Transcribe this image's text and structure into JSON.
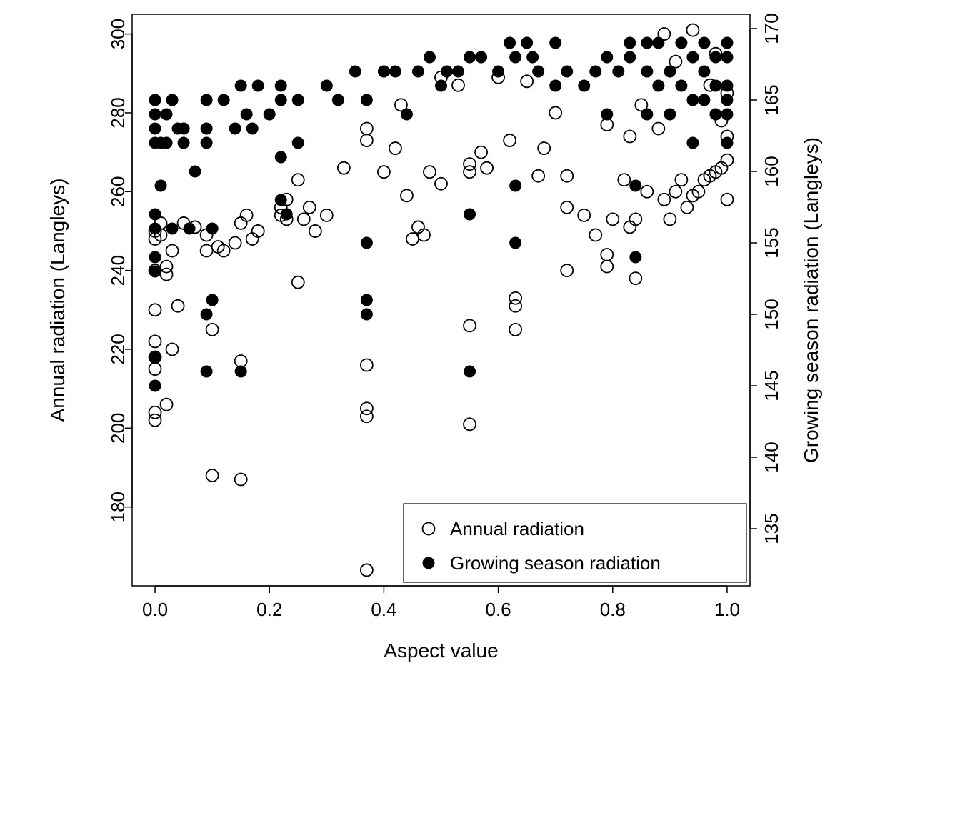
{
  "chart_data": {
    "type": "scatter",
    "xlabel": "Aspect value",
    "ylabel_left": "Annual radiation (Langleys)",
    "ylabel_right": "Growing season radiation (Langleys)",
    "xlim": [
      -0.04,
      1.04
    ],
    "ylim_left": [
      160,
      305
    ],
    "ylim_right": [
      131,
      171
    ],
    "xticks": [
      0.0,
      0.2,
      0.4,
      0.6,
      0.8,
      1.0
    ],
    "yticks_left": [
      180,
      200,
      220,
      240,
      260,
      280,
      300
    ],
    "yticks_right": [
      135,
      140,
      145,
      150,
      155,
      160,
      165,
      170
    ],
    "legend": {
      "entries": [
        {
          "label": "Annual radiation",
          "marker": "open"
        },
        {
          "label": "Growing season radiation",
          "marker": "filled"
        }
      ]
    },
    "series": [
      {
        "name": "Annual radiation",
        "marker": "open",
        "axis": "left",
        "points": [
          {
            "x": 0.0,
            "y": 250
          },
          {
            "x": 0.0,
            "y": 248
          },
          {
            "x": 0.0,
            "y": 222
          },
          {
            "x": 0.0,
            "y": 218
          },
          {
            "x": 0.0,
            "y": 215
          },
          {
            "x": 0.0,
            "y": 230
          },
          {
            "x": 0.0,
            "y": 204
          },
          {
            "x": 0.0,
            "y": 202
          },
          {
            "x": 0.0,
            "y": 240
          },
          {
            "x": 0.01,
            "y": 252
          },
          {
            "x": 0.01,
            "y": 249
          },
          {
            "x": 0.02,
            "y": 241
          },
          {
            "x": 0.02,
            "y": 239
          },
          {
            "x": 0.02,
            "y": 206
          },
          {
            "x": 0.03,
            "y": 245
          },
          {
            "x": 0.03,
            "y": 220
          },
          {
            "x": 0.04,
            "y": 231
          },
          {
            "x": 0.05,
            "y": 252
          },
          {
            "x": 0.07,
            "y": 251
          },
          {
            "x": 0.09,
            "y": 249
          },
          {
            "x": 0.09,
            "y": 245
          },
          {
            "x": 0.1,
            "y": 225
          },
          {
            "x": 0.1,
            "y": 188
          },
          {
            "x": 0.11,
            "y": 246
          },
          {
            "x": 0.12,
            "y": 245
          },
          {
            "x": 0.14,
            "y": 247
          },
          {
            "x": 0.15,
            "y": 252
          },
          {
            "x": 0.15,
            "y": 217
          },
          {
            "x": 0.15,
            "y": 187
          },
          {
            "x": 0.16,
            "y": 254
          },
          {
            "x": 0.17,
            "y": 248
          },
          {
            "x": 0.18,
            "y": 250
          },
          {
            "x": 0.22,
            "y": 256
          },
          {
            "x": 0.22,
            "y": 254
          },
          {
            "x": 0.23,
            "y": 258
          },
          {
            "x": 0.23,
            "y": 253
          },
          {
            "x": 0.25,
            "y": 263
          },
          {
            "x": 0.25,
            "y": 237
          },
          {
            "x": 0.26,
            "y": 253
          },
          {
            "x": 0.27,
            "y": 256
          },
          {
            "x": 0.28,
            "y": 250
          },
          {
            "x": 0.3,
            "y": 254
          },
          {
            "x": 0.33,
            "y": 266
          },
          {
            "x": 0.37,
            "y": 276
          },
          {
            "x": 0.37,
            "y": 273
          },
          {
            "x": 0.37,
            "y": 216
          },
          {
            "x": 0.37,
            "y": 205
          },
          {
            "x": 0.37,
            "y": 203
          },
          {
            "x": 0.37,
            "y": 164
          },
          {
            "x": 0.4,
            "y": 265
          },
          {
            "x": 0.42,
            "y": 271
          },
          {
            "x": 0.43,
            "y": 282
          },
          {
            "x": 0.44,
            "y": 259
          },
          {
            "x": 0.45,
            "y": 248
          },
          {
            "x": 0.46,
            "y": 251
          },
          {
            "x": 0.47,
            "y": 249
          },
          {
            "x": 0.48,
            "y": 265
          },
          {
            "x": 0.5,
            "y": 289
          },
          {
            "x": 0.5,
            "y": 262
          },
          {
            "x": 0.53,
            "y": 287
          },
          {
            "x": 0.55,
            "y": 265
          },
          {
            "x": 0.55,
            "y": 267
          },
          {
            "x": 0.55,
            "y": 226
          },
          {
            "x": 0.55,
            "y": 201
          },
          {
            "x": 0.57,
            "y": 270
          },
          {
            "x": 0.58,
            "y": 266
          },
          {
            "x": 0.6,
            "y": 289
          },
          {
            "x": 0.62,
            "y": 273
          },
          {
            "x": 0.63,
            "y": 233
          },
          {
            "x": 0.63,
            "y": 231
          },
          {
            "x": 0.63,
            "y": 225
          },
          {
            "x": 0.65,
            "y": 288
          },
          {
            "x": 0.67,
            "y": 264
          },
          {
            "x": 0.68,
            "y": 271
          },
          {
            "x": 0.7,
            "y": 280
          },
          {
            "x": 0.72,
            "y": 264
          },
          {
            "x": 0.72,
            "y": 256
          },
          {
            "x": 0.72,
            "y": 240
          },
          {
            "x": 0.75,
            "y": 254
          },
          {
            "x": 0.77,
            "y": 249
          },
          {
            "x": 0.79,
            "y": 277
          },
          {
            "x": 0.79,
            "y": 244
          },
          {
            "x": 0.79,
            "y": 241
          },
          {
            "x": 0.8,
            "y": 253
          },
          {
            "x": 0.82,
            "y": 263
          },
          {
            "x": 0.83,
            "y": 251
          },
          {
            "x": 0.83,
            "y": 274
          },
          {
            "x": 0.84,
            "y": 253
          },
          {
            "x": 0.84,
            "y": 238
          },
          {
            "x": 0.85,
            "y": 282
          },
          {
            "x": 0.86,
            "y": 260
          },
          {
            "x": 0.88,
            "y": 276
          },
          {
            "x": 0.89,
            "y": 258
          },
          {
            "x": 0.89,
            "y": 300
          },
          {
            "x": 0.9,
            "y": 253
          },
          {
            "x": 0.91,
            "y": 293
          },
          {
            "x": 0.91,
            "y": 260
          },
          {
            "x": 0.92,
            "y": 263
          },
          {
            "x": 0.93,
            "y": 256
          },
          {
            "x": 0.94,
            "y": 301
          },
          {
            "x": 0.94,
            "y": 259
          },
          {
            "x": 0.95,
            "y": 260
          },
          {
            "x": 0.96,
            "y": 263
          },
          {
            "x": 0.97,
            "y": 264
          },
          {
            "x": 0.97,
            "y": 287
          },
          {
            "x": 0.98,
            "y": 265
          },
          {
            "x": 0.98,
            "y": 295
          },
          {
            "x": 0.99,
            "y": 278
          },
          {
            "x": 0.99,
            "y": 266
          },
          {
            "x": 1.0,
            "y": 268
          },
          {
            "x": 1.0,
            "y": 258
          },
          {
            "x": 1.0,
            "y": 274
          },
          {
            "x": 1.0,
            "y": 285
          }
        ]
      },
      {
        "name": "Growing season radiation",
        "marker": "filled",
        "axis": "right",
        "points": [
          {
            "x": 0.0,
            "y": 163
          },
          {
            "x": 0.0,
            "y": 164
          },
          {
            "x": 0.0,
            "y": 162
          },
          {
            "x": 0.0,
            "y": 165
          },
          {
            "x": 0.0,
            "y": 153
          },
          {
            "x": 0.0,
            "y": 157
          },
          {
            "x": 0.0,
            "y": 156
          },
          {
            "x": 0.0,
            "y": 154
          },
          {
            "x": 0.0,
            "y": 145
          },
          {
            "x": 0.0,
            "y": 147
          },
          {
            "x": 0.01,
            "y": 162
          },
          {
            "x": 0.01,
            "y": 159
          },
          {
            "x": 0.02,
            "y": 162
          },
          {
            "x": 0.02,
            "y": 164
          },
          {
            "x": 0.03,
            "y": 165
          },
          {
            "x": 0.03,
            "y": 156
          },
          {
            "x": 0.04,
            "y": 163
          },
          {
            "x": 0.05,
            "y": 162
          },
          {
            "x": 0.05,
            "y": 163
          },
          {
            "x": 0.06,
            "y": 156
          },
          {
            "x": 0.07,
            "y": 160
          },
          {
            "x": 0.09,
            "y": 165
          },
          {
            "x": 0.09,
            "y": 162
          },
          {
            "x": 0.09,
            "y": 163
          },
          {
            "x": 0.09,
            "y": 150
          },
          {
            "x": 0.09,
            "y": 146
          },
          {
            "x": 0.1,
            "y": 151
          },
          {
            "x": 0.1,
            "y": 156
          },
          {
            "x": 0.12,
            "y": 165
          },
          {
            "x": 0.14,
            "y": 163
          },
          {
            "x": 0.15,
            "y": 166
          },
          {
            "x": 0.15,
            "y": 146
          },
          {
            "x": 0.16,
            "y": 164
          },
          {
            "x": 0.17,
            "y": 163
          },
          {
            "x": 0.18,
            "y": 166
          },
          {
            "x": 0.2,
            "y": 164
          },
          {
            "x": 0.22,
            "y": 166
          },
          {
            "x": 0.22,
            "y": 165
          },
          {
            "x": 0.22,
            "y": 158
          },
          {
            "x": 0.22,
            "y": 161
          },
          {
            "x": 0.23,
            "y": 157
          },
          {
            "x": 0.25,
            "y": 165
          },
          {
            "x": 0.25,
            "y": 162
          },
          {
            "x": 0.3,
            "y": 166
          },
          {
            "x": 0.32,
            "y": 165
          },
          {
            "x": 0.35,
            "y": 167
          },
          {
            "x": 0.37,
            "y": 165
          },
          {
            "x": 0.37,
            "y": 155
          },
          {
            "x": 0.37,
            "y": 151
          },
          {
            "x": 0.37,
            "y": 150
          },
          {
            "x": 0.4,
            "y": 167
          },
          {
            "x": 0.42,
            "y": 167
          },
          {
            "x": 0.44,
            "y": 164
          },
          {
            "x": 0.46,
            "y": 167
          },
          {
            "x": 0.48,
            "y": 168
          },
          {
            "x": 0.5,
            "y": 166
          },
          {
            "x": 0.51,
            "y": 167
          },
          {
            "x": 0.53,
            "y": 167
          },
          {
            "x": 0.55,
            "y": 168
          },
          {
            "x": 0.55,
            "y": 157
          },
          {
            "x": 0.55,
            "y": 146
          },
          {
            "x": 0.57,
            "y": 168
          },
          {
            "x": 0.6,
            "y": 167
          },
          {
            "x": 0.62,
            "y": 169
          },
          {
            "x": 0.63,
            "y": 168
          },
          {
            "x": 0.63,
            "y": 159
          },
          {
            "x": 0.63,
            "y": 155
          },
          {
            "x": 0.65,
            "y": 169
          },
          {
            "x": 0.66,
            "y": 168
          },
          {
            "x": 0.67,
            "y": 167
          },
          {
            "x": 0.7,
            "y": 169
          },
          {
            "x": 0.7,
            "y": 166
          },
          {
            "x": 0.72,
            "y": 167
          },
          {
            "x": 0.75,
            "y": 166
          },
          {
            "x": 0.77,
            "y": 167
          },
          {
            "x": 0.79,
            "y": 168
          },
          {
            "x": 0.79,
            "y": 164
          },
          {
            "x": 0.81,
            "y": 167
          },
          {
            "x": 0.83,
            "y": 169
          },
          {
            "x": 0.83,
            "y": 168
          },
          {
            "x": 0.84,
            "y": 159
          },
          {
            "x": 0.84,
            "y": 154
          },
          {
            "x": 0.86,
            "y": 169
          },
          {
            "x": 0.86,
            "y": 164
          },
          {
            "x": 0.86,
            "y": 167
          },
          {
            "x": 0.88,
            "y": 169
          },
          {
            "x": 0.88,
            "y": 166
          },
          {
            "x": 0.9,
            "y": 167
          },
          {
            "x": 0.9,
            "y": 164
          },
          {
            "x": 0.92,
            "y": 169
          },
          {
            "x": 0.92,
            "y": 166
          },
          {
            "x": 0.94,
            "y": 168
          },
          {
            "x": 0.94,
            "y": 165
          },
          {
            "x": 0.94,
            "y": 162
          },
          {
            "x": 0.96,
            "y": 169
          },
          {
            "x": 0.96,
            "y": 167
          },
          {
            "x": 0.96,
            "y": 165
          },
          {
            "x": 0.98,
            "y": 166
          },
          {
            "x": 0.98,
            "y": 164
          },
          {
            "x": 0.98,
            "y": 168
          },
          {
            "x": 1.0,
            "y": 169
          },
          {
            "x": 1.0,
            "y": 168
          },
          {
            "x": 1.0,
            "y": 166
          },
          {
            "x": 1.0,
            "y": 165
          },
          {
            "x": 1.0,
            "y": 162
          },
          {
            "x": 1.0,
            "y": 164
          }
        ]
      }
    ]
  }
}
